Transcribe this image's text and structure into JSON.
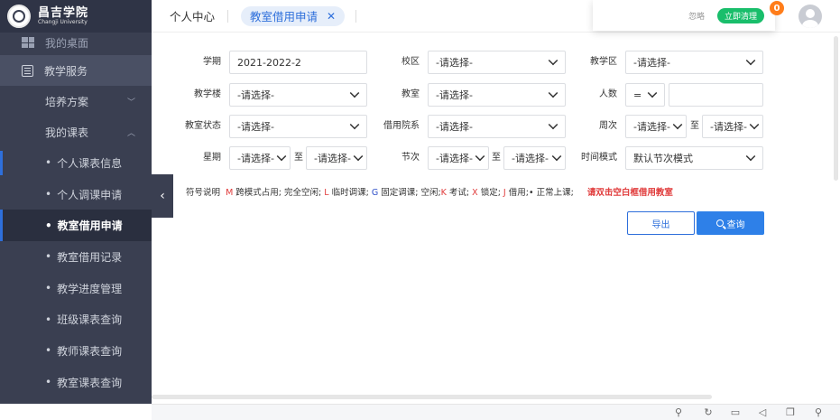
{
  "logo": {
    "name_cn": "昌吉学院",
    "name_en": "Changji University"
  },
  "sidebar": {
    "desktop": "我的桌面",
    "service": "教学服务",
    "plan": "培养方案",
    "schedule": "我的课表",
    "leaves": [
      "个人课表信息",
      "个人调课申请",
      "教室借用申请",
      "教室借用记录",
      "教学进度管理",
      "班级课表查询",
      "教师课表查询",
      "教室课表查询"
    ],
    "active": "教室借用申请"
  },
  "tabs": {
    "home": "个人中心",
    "active": "教室借用申请"
  },
  "notice": {
    "ignore": "忽略",
    "clear": "立即清理",
    "count": "0"
  },
  "form": {
    "xueqi": {
      "label": "学期",
      "value": "2021-2022-2"
    },
    "xiaoqu": {
      "label": "校区",
      "value": "-请选择-"
    },
    "jiaoxuequ": {
      "label": "教学区",
      "value": "-请选择-"
    },
    "jiaoxuelou": {
      "label": "教学楼",
      "value": "-请选择-"
    },
    "jiaoshi": {
      "label": "教室",
      "value": "-请选择-"
    },
    "renshu": {
      "label": "人数",
      "op": "=",
      "value": ""
    },
    "jiaoshizhuangtai": {
      "label": "教室状态",
      "value": "-请选择-"
    },
    "jieyongyuanxi": {
      "label": "借用院系",
      "value": "-请选择-"
    },
    "zhouci": {
      "label": "周次",
      "from": "-请选择-",
      "to": "-请选择-"
    },
    "xingqi": {
      "label": "星期",
      "from": "-请选择-",
      "to": "-请选择-"
    },
    "jieci": {
      "label": "节次",
      "from": "-请选择-",
      "to": "-请选择-"
    },
    "shijianmoshi": {
      "label": "时间模式",
      "value": "默认节次模式"
    },
    "zhi": "至"
  },
  "legend": {
    "title": "符号说明",
    "m": "M",
    "m_text": "跨模式占用; 完全空闲;",
    "l": "L",
    "l_text": "临时调课;",
    "g": "G",
    "g_text": "固定调课; 空闲;",
    "k": "K",
    "k_text": "考试;",
    "x": "X",
    "x_text": "锁定;",
    "j": "J",
    "j_text": "借用;",
    "dot_text": "• 正常上课;",
    "hint": "请双击空白框借用教室"
  },
  "buttons": {
    "export": "导出",
    "query": "查询"
  },
  "colors": {
    "primary": "#2e80e8",
    "sidebar": "#3a3f51",
    "green": "#19be6b",
    "red": "#e03a3a"
  }
}
